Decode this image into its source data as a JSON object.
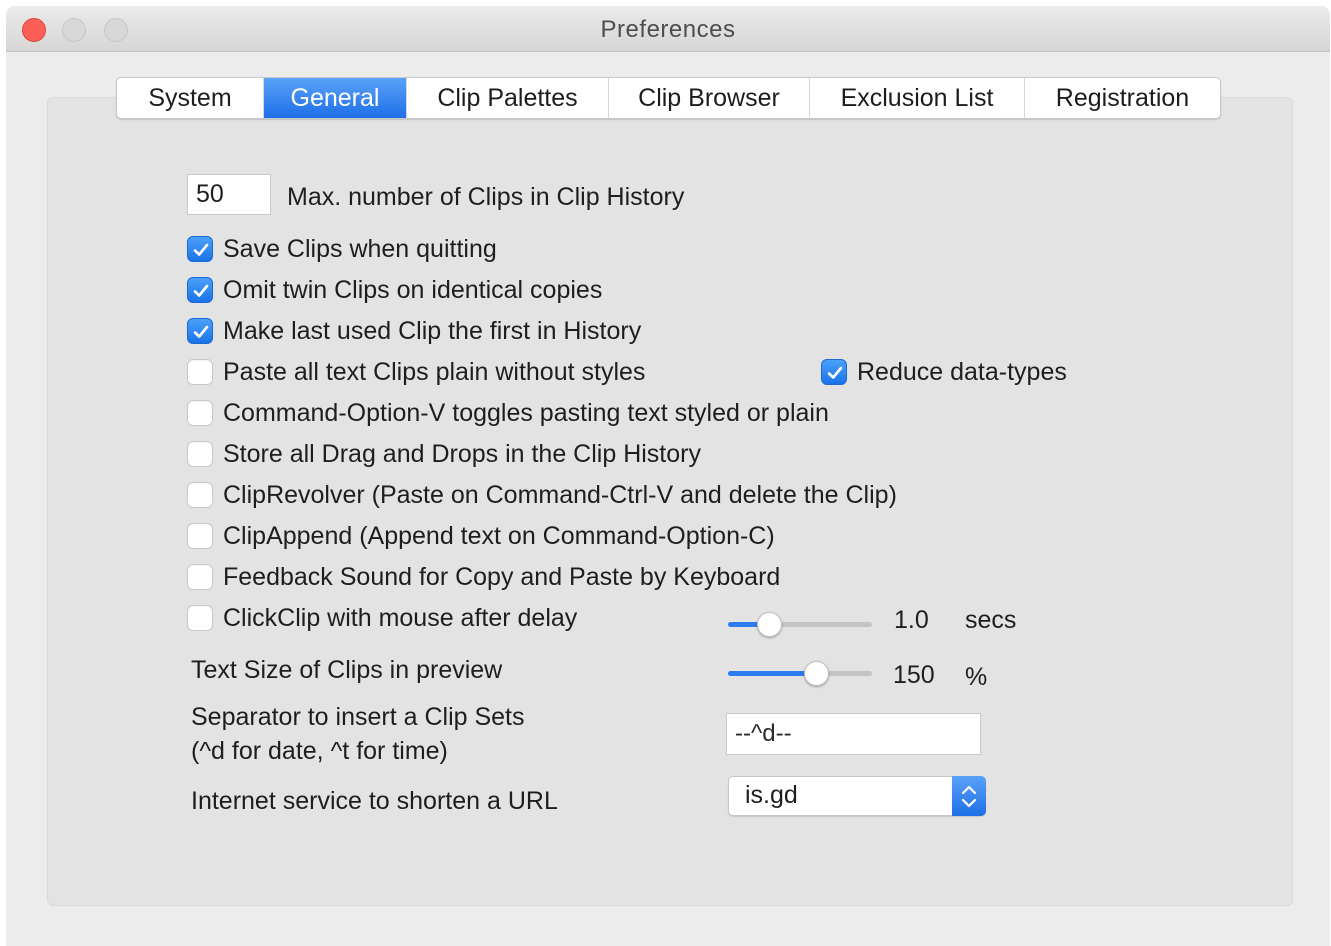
{
  "window": {
    "title": "Preferences"
  },
  "tabs": [
    {
      "label": "System",
      "active": false
    },
    {
      "label": "General",
      "active": true
    },
    {
      "label": "Clip Palettes",
      "active": false
    },
    {
      "label": "Clip Browser",
      "active": false
    },
    {
      "label": "Exclusion List",
      "active": false
    },
    {
      "label": "Registration",
      "active": false
    }
  ],
  "max_clips": {
    "value": "50",
    "label": "Max. number of Clips in Clip History"
  },
  "options": [
    {
      "label": "Save Clips when quitting",
      "checked": true
    },
    {
      "label": "Omit twin Clips on identical copies",
      "checked": true
    },
    {
      "label": "Make last used Clip the first in History",
      "checked": true
    },
    {
      "label": "Paste all text Clips plain without styles",
      "checked": false
    },
    {
      "label": "Command-Option-V toggles pasting text styled or plain",
      "checked": false
    },
    {
      "label": "Store all Drag and Drops in the Clip History",
      "checked": false
    },
    {
      "label": "ClipRevolver (Paste on Command-Ctrl-V and delete the Clip)",
      "checked": false
    },
    {
      "label": "ClipAppend (Append text on Command-Option-C)",
      "checked": false
    },
    {
      "label": "Feedback Sound for Copy and Paste by Keyboard",
      "checked": false
    },
    {
      "label": "ClickClip with mouse after delay",
      "checked": false
    }
  ],
  "reduce_datatypes": {
    "label": "Reduce data-types",
    "checked": true
  },
  "click_delay": {
    "value": "1.0",
    "unit": "secs",
    "fraction": 0.24
  },
  "text_size": {
    "label": "Text Size of Clips in preview",
    "value": "150",
    "unit": "%",
    "fraction": 0.64
  },
  "separator": {
    "label_line1": "Separator to insert a Clip Sets",
    "label_line2": "(^d for date, ^t for time)",
    "value": "--^d--"
  },
  "url_service": {
    "label": "Internet service to shorten a URL",
    "value": "is.gd"
  },
  "colors": {
    "accent": "#1e6fe8",
    "close": "#fc5f57",
    "panel": "#e3e3e3"
  }
}
